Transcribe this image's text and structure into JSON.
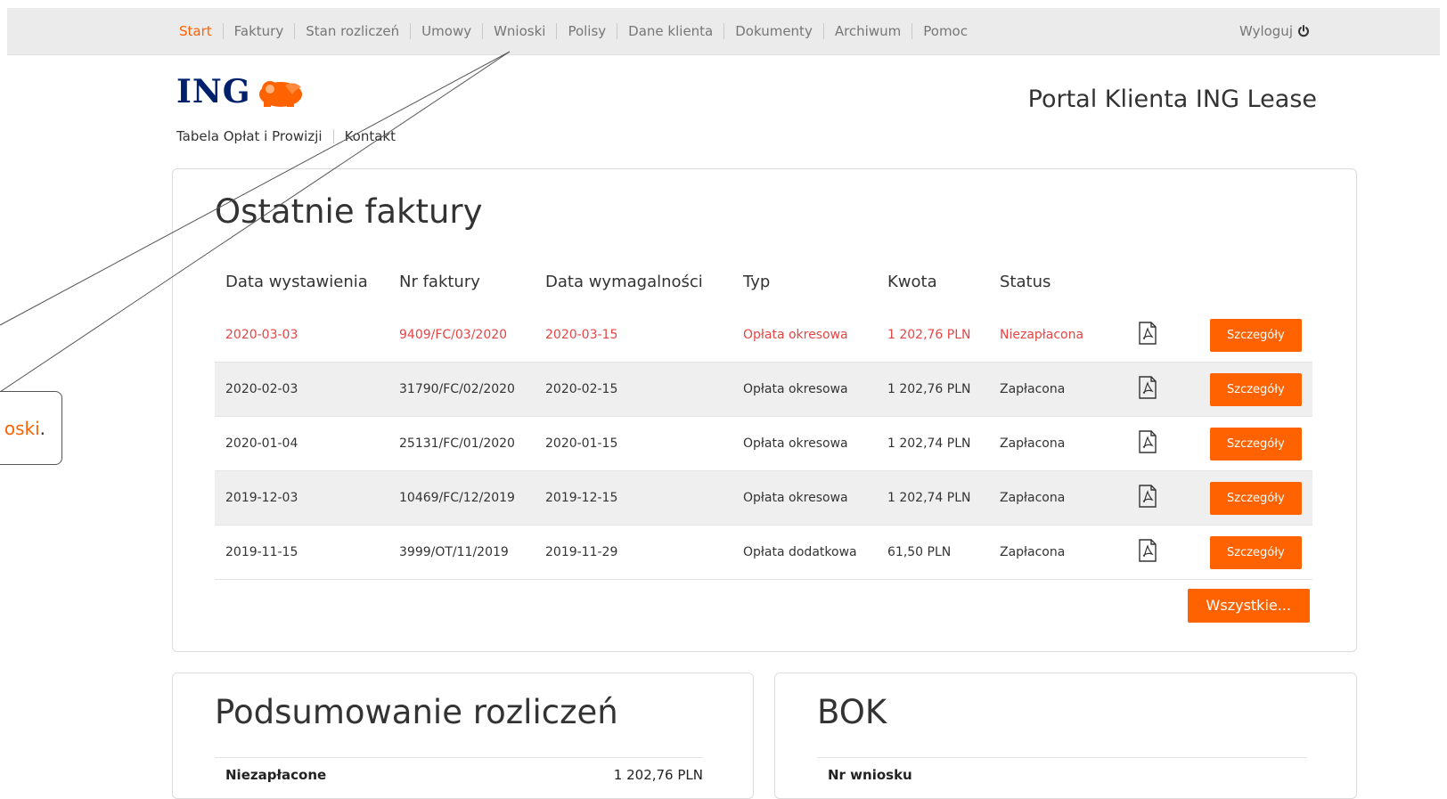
{
  "nav": {
    "items": [
      "Start",
      "Faktury",
      "Stan rozliczeń",
      "Umowy",
      "Wnioski",
      "Polisy",
      "Dane klienta",
      "Dokumenty",
      "Archiwum",
      "Pomoc"
    ],
    "active_index": 0,
    "logout_label": "Wyloguj"
  },
  "header": {
    "logo_text": "ING",
    "portal_title": "Portal Klienta ING Lease",
    "sublinks": [
      "Tabela Opłat i Prowizji",
      "Kontakt"
    ]
  },
  "invoices": {
    "title": "Ostatnie faktury",
    "columns": [
      "Data wystawienia",
      "Nr faktury",
      "Data wymagalności",
      "Typ",
      "Kwota",
      "Status"
    ],
    "rows": [
      {
        "issued": "2020-03-03",
        "number": "9409/FC/03/2020",
        "due": "2020-03-15",
        "type": "Opłata okresowa",
        "amount": "1 202,76 PLN",
        "status": "Niezapłacona",
        "unpaid": true
      },
      {
        "issued": "2020-02-03",
        "number": "31790/FC/02/2020",
        "due": "2020-02-15",
        "type": "Opłata okresowa",
        "amount": "1 202,76 PLN",
        "status": "Zapłacona",
        "unpaid": false
      },
      {
        "issued": "2020-01-04",
        "number": "25131/FC/01/2020",
        "due": "2020-01-15",
        "type": "Opłata okresowa",
        "amount": "1 202,74 PLN",
        "status": "Zapłacona",
        "unpaid": false
      },
      {
        "issued": "2019-12-03",
        "number": "10469/FC/12/2019",
        "due": "2019-12-15",
        "type": "Opłata okresowa",
        "amount": "1 202,74 PLN",
        "status": "Zapłacona",
        "unpaid": false
      },
      {
        "issued": "2019-11-15",
        "number": "3999/OT/11/2019",
        "due": "2019-11-29",
        "type": "Opłata dodatkowa",
        "amount": "61,50 PLN",
        "status": "Zapłacona",
        "unpaid": false
      }
    ],
    "details_label": "Szczegóły",
    "all_label": "Wszystkie..."
  },
  "summary": {
    "title": "Podsumowanie rozliczeń",
    "first_row_label": "Niezapłacone",
    "first_row_value": "1 202,76 PLN"
  },
  "bok": {
    "title": "BOK",
    "first_row_label": "Nr wniosku"
  },
  "callout": {
    "text_highlight": "oski",
    "text_tail": "."
  },
  "colors": {
    "accent": "#ff6200",
    "unpaid": "#e64545",
    "brand_navy": "#00206b",
    "nav_bg": "#ebebeb"
  }
}
